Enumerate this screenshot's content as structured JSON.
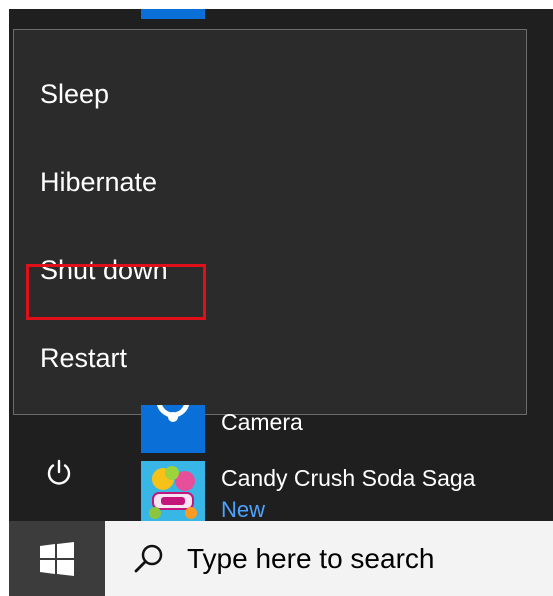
{
  "power_menu": {
    "items": [
      {
        "label": "Sleep"
      },
      {
        "label": "Hibernate"
      },
      {
        "label": "Shut down"
      },
      {
        "label": "Restart"
      }
    ]
  },
  "apps": [
    {
      "name": "Camera",
      "icon": "camera-icon"
    },
    {
      "name": "Candy Crush Soda Saga",
      "badge": "New",
      "icon": "candy-crush-icon"
    }
  ],
  "taskbar": {
    "search_placeholder": "Type here to search"
  },
  "icons": {
    "power": "power-icon",
    "start": "windows-logo-icon",
    "search": "search-icon"
  },
  "colors": {
    "highlight": "#e0101a",
    "tile_blue": "#0a6fd6",
    "badge_blue": "#4ea2ff"
  }
}
